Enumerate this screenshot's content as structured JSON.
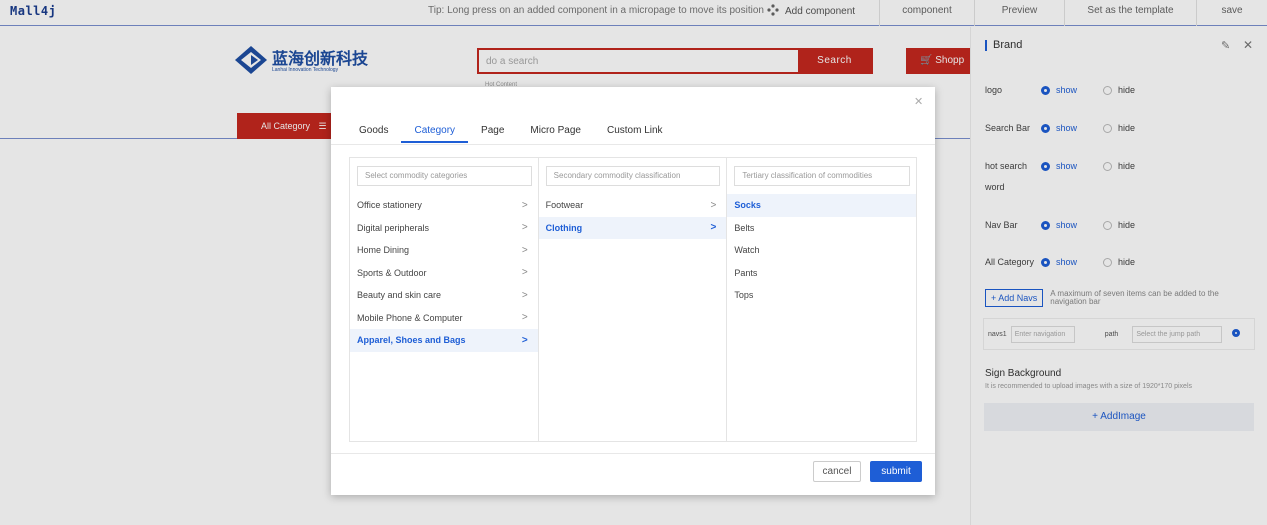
{
  "topbar": {
    "logo": "Mall4j",
    "tip": "Tip: Long press on an added component in a micropage to move its position",
    "add_component": "Add component",
    "component": "component",
    "preview": "Preview",
    "set_template": "Set as the template",
    "save": "save"
  },
  "canvas": {
    "brand_cn": "蓝海创新科技",
    "brand_en": "Lanhai Innovation Technology",
    "search_placeholder": "do a search",
    "search_button": "Search",
    "cart_label": "Shopp",
    "hot_content": "Hot Content",
    "all_category": "All Category"
  },
  "panel": {
    "title": "Brand",
    "show": "show",
    "hide": "hide",
    "rows": {
      "logo": "logo",
      "search_bar": "Search Bar",
      "hot_search_1": "hot search",
      "hot_search_2": "word",
      "nav_bar": "Nav Bar",
      "all_category": "All Category"
    },
    "add_navs": "+ Add Navs",
    "add_navs_hint": "A maximum of seven items can be added to the navigation bar",
    "navs1": "navs1",
    "navs1_placeholder": "Enter navigation",
    "path": "path",
    "path_placeholder": "Select the jump path",
    "sign_title": "Sign Background",
    "sign_hint": "It is recommended to upload images with a size of 1920*170 pixels",
    "add_image": "+ AddImage"
  },
  "modal": {
    "tabs": [
      "Goods",
      "Category",
      "Page",
      "Micro Page",
      "Custom Link"
    ],
    "active_tab": "Category",
    "col1_placeholder": "Select commodity categories",
    "col2_placeholder": "Secondary commodity classification",
    "col3_placeholder": "Tertiary classification of commodities",
    "col1": [
      "Office stationery",
      "Digital peripherals",
      "Home Dining",
      "Sports & Outdoor",
      "Beauty and skin care",
      "Mobile Phone & Computer",
      "Apparel, Shoes and Bags"
    ],
    "col2": [
      "Footwear",
      "Clothing"
    ],
    "col3": [
      "Socks",
      "Belts",
      "Watch",
      "Pants",
      "Tops"
    ],
    "selected": {
      "col1": 6,
      "col2": 1,
      "col3": 0
    },
    "cancel": "cancel",
    "submit": "submit"
  },
  "colors": {
    "accent": "#1e5ed6",
    "brand_red": "#c5281f"
  }
}
